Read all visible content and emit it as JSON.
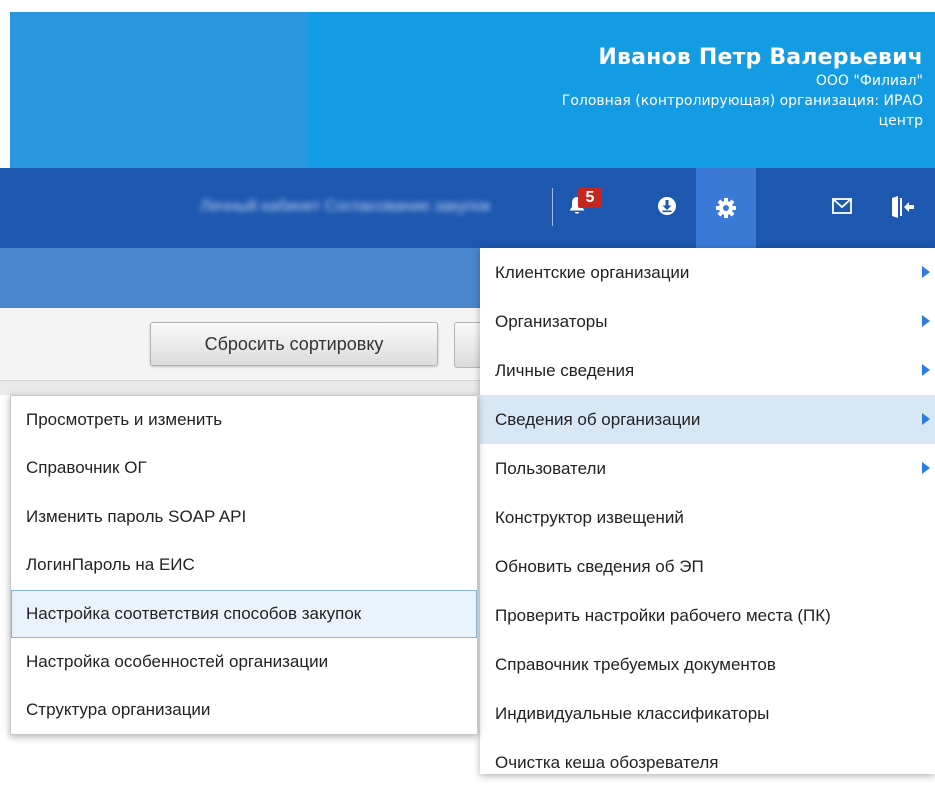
{
  "header": {
    "user_name": "Иванов Петр Валерьевич",
    "organization": "ООО \"Филиал\"",
    "parent_org_line1": "Головная (контролирующая) организация: ИРАО",
    "parent_org_line2": "центр",
    "colors": {
      "left_block": "#2a96dd",
      "right_block": "#139be4"
    }
  },
  "navbar": {
    "blurred_menu_text": "Личный кабинет   Согласование закупок",
    "notification_count": "5",
    "icons": [
      "bell-icon",
      "download-icon",
      "gear-icon",
      "mail-icon",
      "logout-icon"
    ],
    "colors": {
      "background": "#1d57b0",
      "active_button": "#3a79d6",
      "badge": "#c3271e"
    }
  },
  "toolbar": {
    "reset_sort_label": "Сбросить сортировку"
  },
  "settings_menu": {
    "items": [
      {
        "label": "Клиентские организации",
        "has_submenu": true
      },
      {
        "label": "Организаторы",
        "has_submenu": true
      },
      {
        "label": "Личные сведения",
        "has_submenu": true
      },
      {
        "label": "Сведения об организации",
        "has_submenu": true,
        "active": true
      },
      {
        "label": "Пользователи",
        "has_submenu": true
      },
      {
        "label": "Конструктор извещений",
        "has_submenu": false
      },
      {
        "label": "Обновить сведения об ЭП",
        "has_submenu": false
      },
      {
        "label": "Проверить настройки рабочего места (ПК)",
        "has_submenu": false
      },
      {
        "label": "Справочник требуемых документов",
        "has_submenu": false
      },
      {
        "label": "Индивидуальные классификаторы",
        "has_submenu": false
      },
      {
        "label": "Очистка кеша обозревателя",
        "has_submenu": false
      }
    ],
    "colors": {
      "active_item": "#d7e7f6",
      "arrow": "#2d7de0"
    }
  },
  "org_submenu": {
    "items": [
      {
        "label": "Просмотреть и изменить"
      },
      {
        "label": "Справочник ОГ"
      },
      {
        "label": "Изменить пароль SOAP API"
      },
      {
        "label": "ЛогинПароль на ЕИС"
      },
      {
        "label": "Настройка соответствия способов закупок",
        "selected": true
      },
      {
        "label": "Настройка особенностей организации"
      },
      {
        "label": "Структура организации"
      }
    ],
    "colors": {
      "selected_bg": "#eaf3fb",
      "selected_border": "#87b2dc"
    }
  }
}
